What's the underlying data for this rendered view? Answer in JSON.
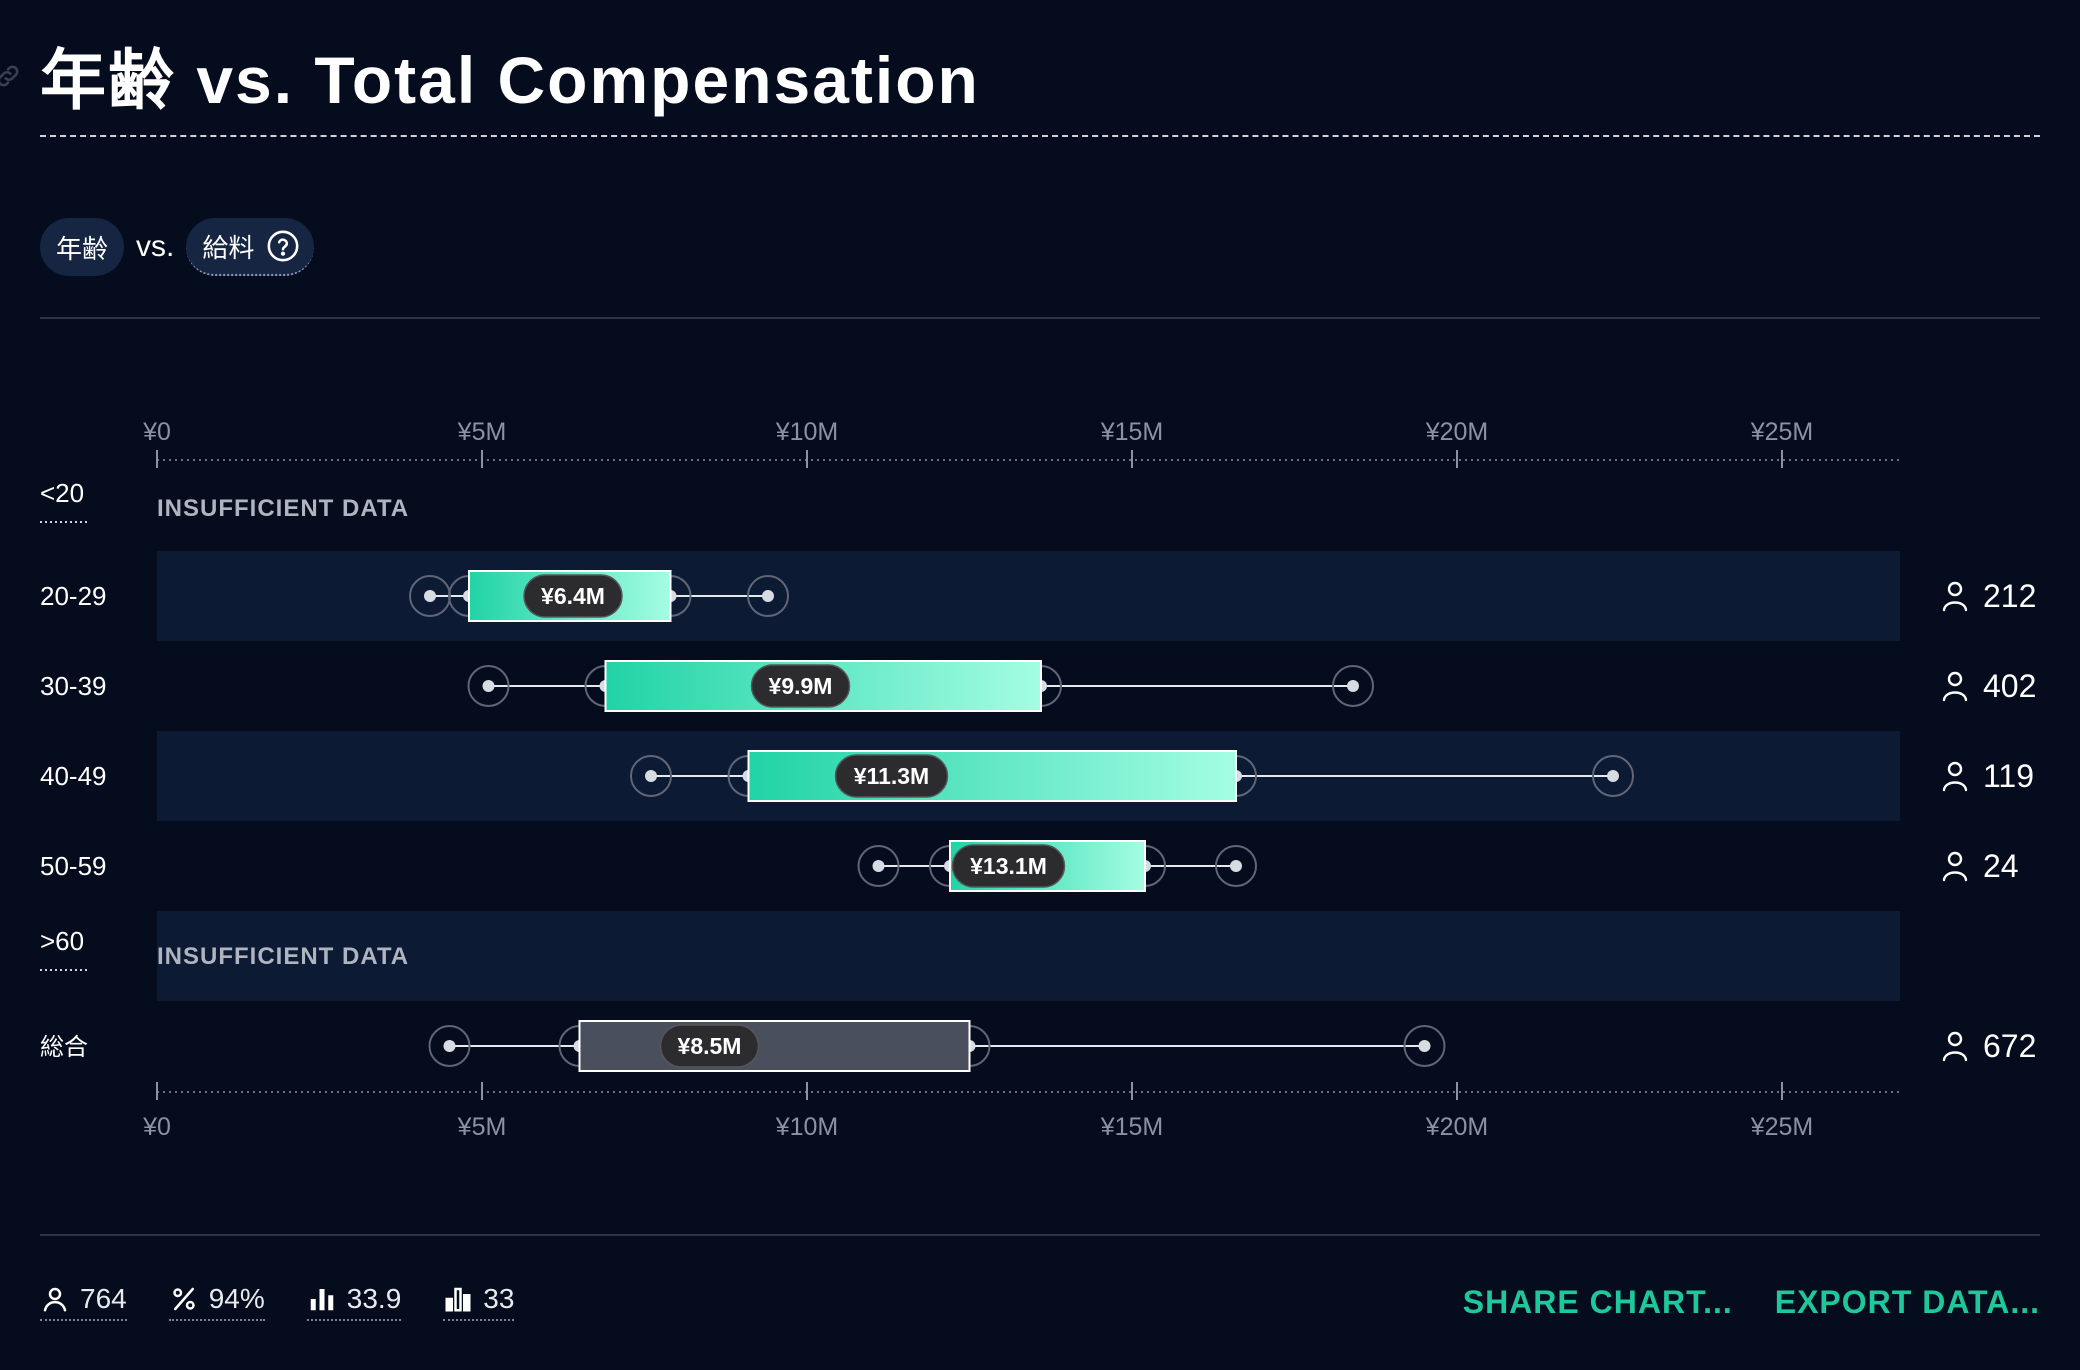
{
  "title": "年齢 vs. Total Compensation",
  "selector": {
    "left_label": "年齢",
    "vs": "vs.",
    "right_label": "給料"
  },
  "chart_data": {
    "type": "boxplot",
    "x_axis": {
      "min": 0,
      "max": 27,
      "ticks": [
        0,
        5,
        10,
        15,
        20,
        25
      ],
      "tick_labels": [
        "¥0",
        "¥5M",
        "¥10M",
        "¥15M",
        "¥20M",
        "¥25M"
      ]
    },
    "rows": [
      {
        "label": "<20",
        "status": "INSUFFICIENT DATA"
      },
      {
        "label": "20-29",
        "min": 4.2,
        "q1": 4.8,
        "median": 6.4,
        "q3": 7.9,
        "max": 9.4,
        "count": "212"
      },
      {
        "label": "30-39",
        "min": 5.1,
        "q1": 6.9,
        "median": 9.9,
        "q3": 13.6,
        "max": 18.4,
        "count": "402"
      },
      {
        "label": "40-49",
        "min": 7.6,
        "q1": 9.1,
        "median": 11.3,
        "q3": 16.6,
        "max": 22.4,
        "count": "119"
      },
      {
        "label": "50-59",
        "min": 11.1,
        "q1": 12.2,
        "median": 13.1,
        "q3": 15.2,
        "max": 16.6,
        "count": "24"
      },
      {
        "label": ">60",
        "status": "INSUFFICIENT DATA"
      },
      {
        "label": "総合",
        "min": 4.5,
        "q1": 6.5,
        "median": 8.5,
        "q3": 12.5,
        "max": 19.5,
        "count": "672",
        "total": true
      }
    ],
    "median_labels": [
      "¥6.4M",
      "¥9.9M",
      "¥11.3M",
      "¥13.1M",
      "¥8.5M"
    ]
  },
  "footer": {
    "stats": [
      {
        "icon": "person-icon",
        "value": "764"
      },
      {
        "icon": "percent-icon",
        "value": "94%"
      },
      {
        "icon": "bar-chart-icon",
        "value": "33.9"
      },
      {
        "icon": "bar-chart-outline-icon",
        "value": "33"
      }
    ],
    "share_label": "SHARE CHART...",
    "export_label": "EXPORT DATA..."
  },
  "colors": {
    "background": "#050c1d",
    "band": "#0d1a33",
    "accent": "#1fc89a",
    "box_start": "#21d3a6",
    "box_end": "#a4fde3",
    "total_box": "#4a4f5e"
  }
}
